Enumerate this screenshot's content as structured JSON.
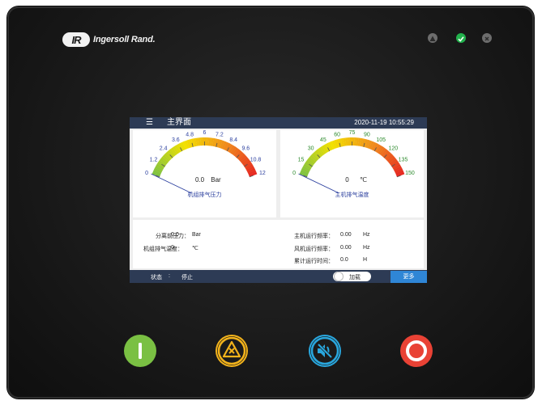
{
  "brand": {
    "logo_mark": "IR",
    "logo_text": "Ingersoll Rand."
  },
  "screen": {
    "title": "主界面",
    "datetime": "2020-11-19 10:55:29",
    "menu_icon": "hamburger-menu-icon"
  },
  "chart_data": [
    {
      "type": "gauge",
      "title": "机组排气压力",
      "unit": "Bar",
      "value": 0.0,
      "value_text": "0.0",
      "range": [
        0,
        12
      ],
      "ticks": [
        "0",
        "1.2",
        "2.4",
        "3.6",
        "4.8",
        "6",
        "7.2",
        "8.4",
        "9.6",
        "10.8",
        "12"
      ],
      "tick_color": "#2b3f9e",
      "arc_colors": [
        "#7fc241",
        "#f2e000",
        "#f08a1c",
        "#e52421"
      ]
    },
    {
      "type": "gauge",
      "title": "主机排气温度",
      "unit": "℃",
      "value": 0,
      "value_text": "0",
      "range": [
        0,
        150
      ],
      "ticks": [
        "0",
        "15",
        "30",
        "45",
        "60",
        "75",
        "90",
        "105",
        "120",
        "135",
        "150"
      ],
      "tick_color": "#2e8b2e",
      "arc_colors": [
        "#7fc241",
        "#f2e000",
        "#f08a1c",
        "#e52421"
      ]
    }
  ],
  "info": {
    "left": [
      {
        "label": "分离前压力：",
        "value": "0.0",
        "unit": "Bar"
      },
      {
        "label": "机组排气温度：",
        "value": "0",
        "unit": "℃"
      }
    ],
    "right": [
      {
        "label": "主机运行频率：",
        "value": "0.00",
        "unit": "Hz"
      },
      {
        "label": "风机运行频率：",
        "value": "0.00",
        "unit": "Hz"
      },
      {
        "label": "累计运行时间：",
        "value": "0.0",
        "unit": "H"
      }
    ]
  },
  "status": {
    "label": "状态",
    "colon": ":",
    "value": "停止",
    "load_label": "加载",
    "more_label": "更多"
  },
  "leds": [
    {
      "name": "warning-led-icon",
      "color": "#6d6d6d"
    },
    {
      "name": "ok-led-icon",
      "color": "#22b14c"
    },
    {
      "name": "fault-led-icon",
      "color": "#6d6d6d"
    }
  ],
  "buttons": [
    {
      "name": "start-button",
      "color": "#7ac043"
    },
    {
      "name": "alarm-reset-button",
      "color": "#f3b31b"
    },
    {
      "name": "mute-button",
      "color": "#29a7de"
    },
    {
      "name": "stop-button",
      "color": "#e94235"
    }
  ]
}
